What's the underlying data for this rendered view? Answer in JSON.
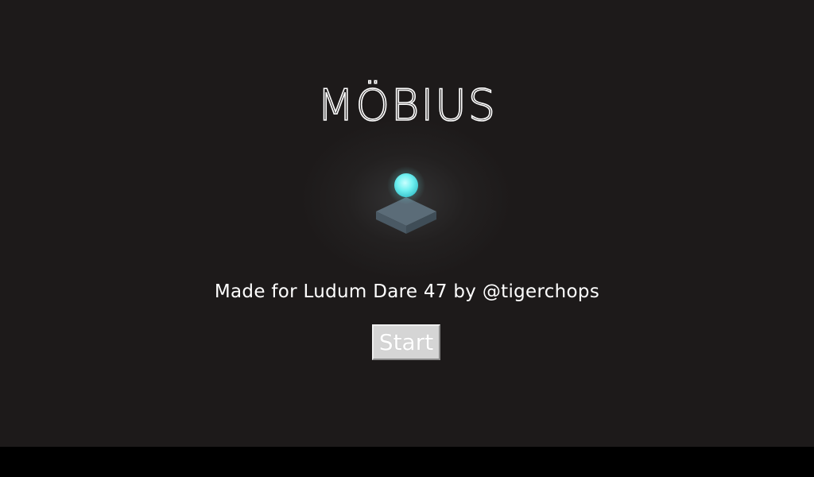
{
  "game": {
    "title": "MÖBIUS",
    "credit": "Made for Ludum Dare 47 by @tigerchops",
    "start_label": "Start"
  },
  "colors": {
    "background": "#1d1a1a",
    "letterbox": "#000000",
    "orb": "#6ff0f0",
    "platform_top": "#5b6c78",
    "platform_side": "#3f4d57",
    "button": "#d5d5d5",
    "text": "#ffffff"
  },
  "icons": {
    "hero": "glowing-orb-on-platform-icon"
  }
}
